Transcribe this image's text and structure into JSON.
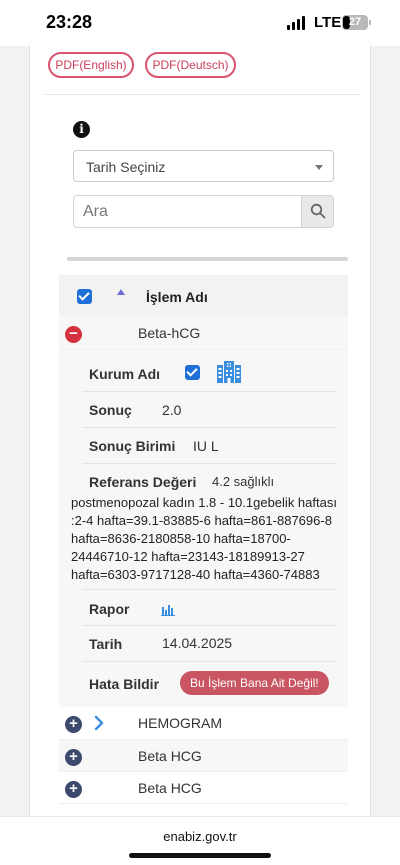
{
  "status_bar": {
    "time": "23:28",
    "network": "LTE",
    "battery": "27"
  },
  "pdf_buttons": {
    "english": "PDF(English)",
    "deutsch": "PDF(Deutsch)"
  },
  "filters": {
    "date_select": "Tarih Seçiniz",
    "search_placeholder": "Ara"
  },
  "table": {
    "header": "İşlem Adı",
    "expanded_row": {
      "name": "Beta-hCG",
      "details": {
        "institution_label": "Kurum Adı",
        "result_label": "Sonuç",
        "result_value": "2.0",
        "unit_label": "Sonuç Birimi",
        "unit_value": "IU L",
        "reference_label": "Referans Değeri",
        "reference_first": "4.2 sağlıklı",
        "reference_rest": "postmenopozal kadın 1.8 - 10.1gebelik haftası :2-4 hafta=39.1-83885-6 hafta=861-887696-8 hafta=8636-2180858-10 hafta=18700-24446710-12 hafta=23143-18189913-27 hafta=6303-9717128-40 hafta=4360-74883",
        "report_label": "Rapor",
        "date_label": "Tarih",
        "date_value": "14.04.2025",
        "report_error_label": "Hata Bildir",
        "report_error_button": "Bu İşlem Bana Ait Değil!"
      }
    },
    "rows": [
      {
        "name": "HEMOGRAM"
      },
      {
        "name": "Beta HCG"
      },
      {
        "name": "Beta HCG"
      }
    ]
  },
  "footer": {
    "url": "enabiz.gov.tr"
  },
  "colors": {
    "pdf_accent": "#d9536f",
    "checkbox": "#1f6fd6",
    "error_button": "#c85561",
    "expand_minus": "#d5323f",
    "expand_plus": "#3c4a6e"
  }
}
